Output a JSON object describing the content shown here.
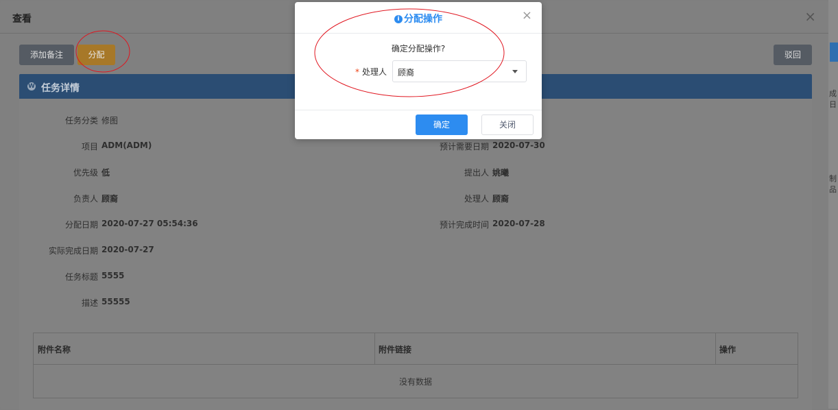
{
  "panel": {
    "title": "查看",
    "close_glyph": "×",
    "buttons": {
      "add_note": "添加备注",
      "assign": "分配",
      "withdraw": "驳回"
    },
    "section_title": "任务详情",
    "fields_left": [
      {
        "label": "任务分类",
        "value": "修图"
      },
      {
        "label": "项目",
        "value": "ADM(ADM)"
      },
      {
        "label": "优先级",
        "value": "低"
      },
      {
        "label": "负责人",
        "value": "顾裔"
      },
      {
        "label": "分配日期",
        "value": "2020-07-27 05:54:36"
      },
      {
        "label": "实际完成日期",
        "value": "2020-07-27"
      },
      {
        "label": "任务标题",
        "value": "5555"
      },
      {
        "label": "描述",
        "value": "55555"
      }
    ],
    "fields_right": [
      {
        "label": "预计需要日期",
        "value": "2020-07-30"
      },
      {
        "label": "提出人",
        "value": "姚曦"
      },
      {
        "label": "处理人",
        "value": "顾裔"
      },
      {
        "label": "预计完成时间",
        "value": "2020-07-28"
      }
    ],
    "attachments": {
      "columns": [
        "附件名称",
        "附件链接",
        "操作"
      ],
      "empty_text": "没有数据"
    }
  },
  "background_edge": {
    "text1": "成日",
    "text2": "制品"
  },
  "modal": {
    "title": "分配操作",
    "info_icon": "i",
    "close_glyph": "×",
    "confirm_text": "确定分配操作?",
    "handler_label": "处理人",
    "required_mark": "*",
    "handler_value": "顾裔",
    "ok_label": "确定",
    "close_label": "关闭"
  },
  "annotations": {
    "color": "#e0141e"
  }
}
